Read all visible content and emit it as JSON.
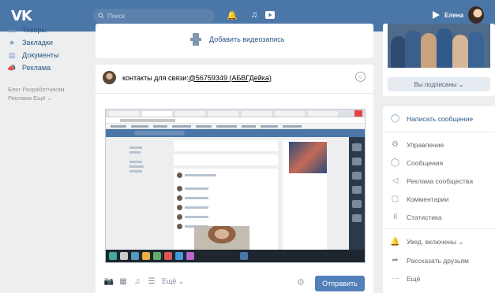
{
  "header": {
    "logo": "VK",
    "search_placeholder": "Поиск",
    "user_name": "Елена",
    "icons": [
      "bell-icon",
      "music-icon",
      "play-icon"
    ]
  },
  "left_nav": {
    "items": [
      {
        "label": "Товары",
        "icon": "goods-icon"
      },
      {
        "label": "Закладки",
        "icon": "star-icon"
      },
      {
        "label": "Документы",
        "icon": "document-icon"
      },
      {
        "label": "Реклама",
        "icon": "ads-icon"
      }
    ],
    "footer_line1": "Блог  Разработчикам",
    "footer_line2": "Реклама  Ещё ⌄"
  },
  "main": {
    "add_video_label": "Добавить видеозапись",
    "post_text": "контакты для связи:@56759349 (АБВГДейка)",
    "post_text_plain": "контакты для связи:",
    "post_link": "@56759349 (АБВГДейка)",
    "tools_more": "Ещё ⌄",
    "send_label": "Отправить"
  },
  "right": {
    "subscribed_label": "Вы подписаны ⌄",
    "actions": [
      {
        "label": "Написать сообщение",
        "icon": "message-icon",
        "style": "link"
      },
      {
        "label": "Управление",
        "icon": "gear-icon",
        "style": "grey"
      },
      {
        "label": "Сообщения",
        "icon": "chat-icon",
        "style": "grey"
      },
      {
        "label": "Реклама сообщества",
        "icon": "megaphone-icon",
        "style": "grey"
      },
      {
        "label": "Комментарии",
        "icon": "comment-icon",
        "style": "grey"
      },
      {
        "label": "Статистика",
        "icon": "stats-icon",
        "style": "grey"
      },
      {
        "label": "Увед. включены ⌄",
        "icon": "bell-icon",
        "style": "grey"
      },
      {
        "label": "Рассказать друзьям",
        "icon": "share-icon",
        "style": "grey"
      },
      {
        "label": "Ещё",
        "icon": "more-icon",
        "style": "grey"
      }
    ]
  },
  "colors": {
    "header": "#4a76a8",
    "background": "#edeef0",
    "link": "#2a5885",
    "button": "#5181b8"
  }
}
